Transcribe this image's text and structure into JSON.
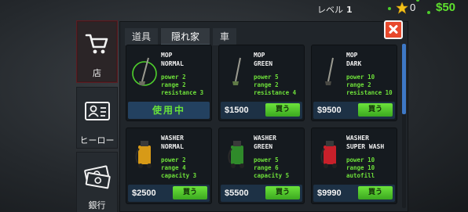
{
  "hud": {
    "level_label": "レベル",
    "level_value": "1",
    "stars": "0",
    "money": "$50"
  },
  "nav": {
    "items": [
      {
        "label": "店",
        "icon": "cart-icon"
      },
      {
        "label": "ヒーロー",
        "icon": "id-card-icon"
      },
      {
        "label": "銀行",
        "icon": "money-icon"
      }
    ]
  },
  "tabs": [
    {
      "label": "道具"
    },
    {
      "label": "隠れ家"
    },
    {
      "label": "車"
    }
  ],
  "cards": [
    {
      "name": "MOP\nNORMAL",
      "stats": "power 2\nrange 2\nresistance 3",
      "price": "",
      "status": "使用中"
    },
    {
      "name": "MOP\nGREEN",
      "stats": "power 5\nrange 2\nresistance 4",
      "price": "$1500",
      "buy": "買う"
    },
    {
      "name": "MOP\nDARK",
      "stats": "power 10\nrange 2\nresistance 10",
      "price": "$9500",
      "buy": "買う"
    },
    {
      "name": "WASHER\nNORMAL",
      "stats": "power 2\nrange 4\ncapacity 3",
      "price": "$2500",
      "buy": "買う"
    },
    {
      "name": "WASHER\nGREEN",
      "stats": "power 5\nrange 6\ncapacity 5",
      "price": "$5500",
      "buy": "買う"
    },
    {
      "name": "WASHER\nSUPER WASH",
      "stats": "power 10\nrange 10\nautofill",
      "price": "$9990",
      "buy": "買う"
    }
  ],
  "colors": {
    "accent_green": "#6ee03a",
    "close_red": "#e8492c",
    "card_bg": "#151a1f"
  }
}
